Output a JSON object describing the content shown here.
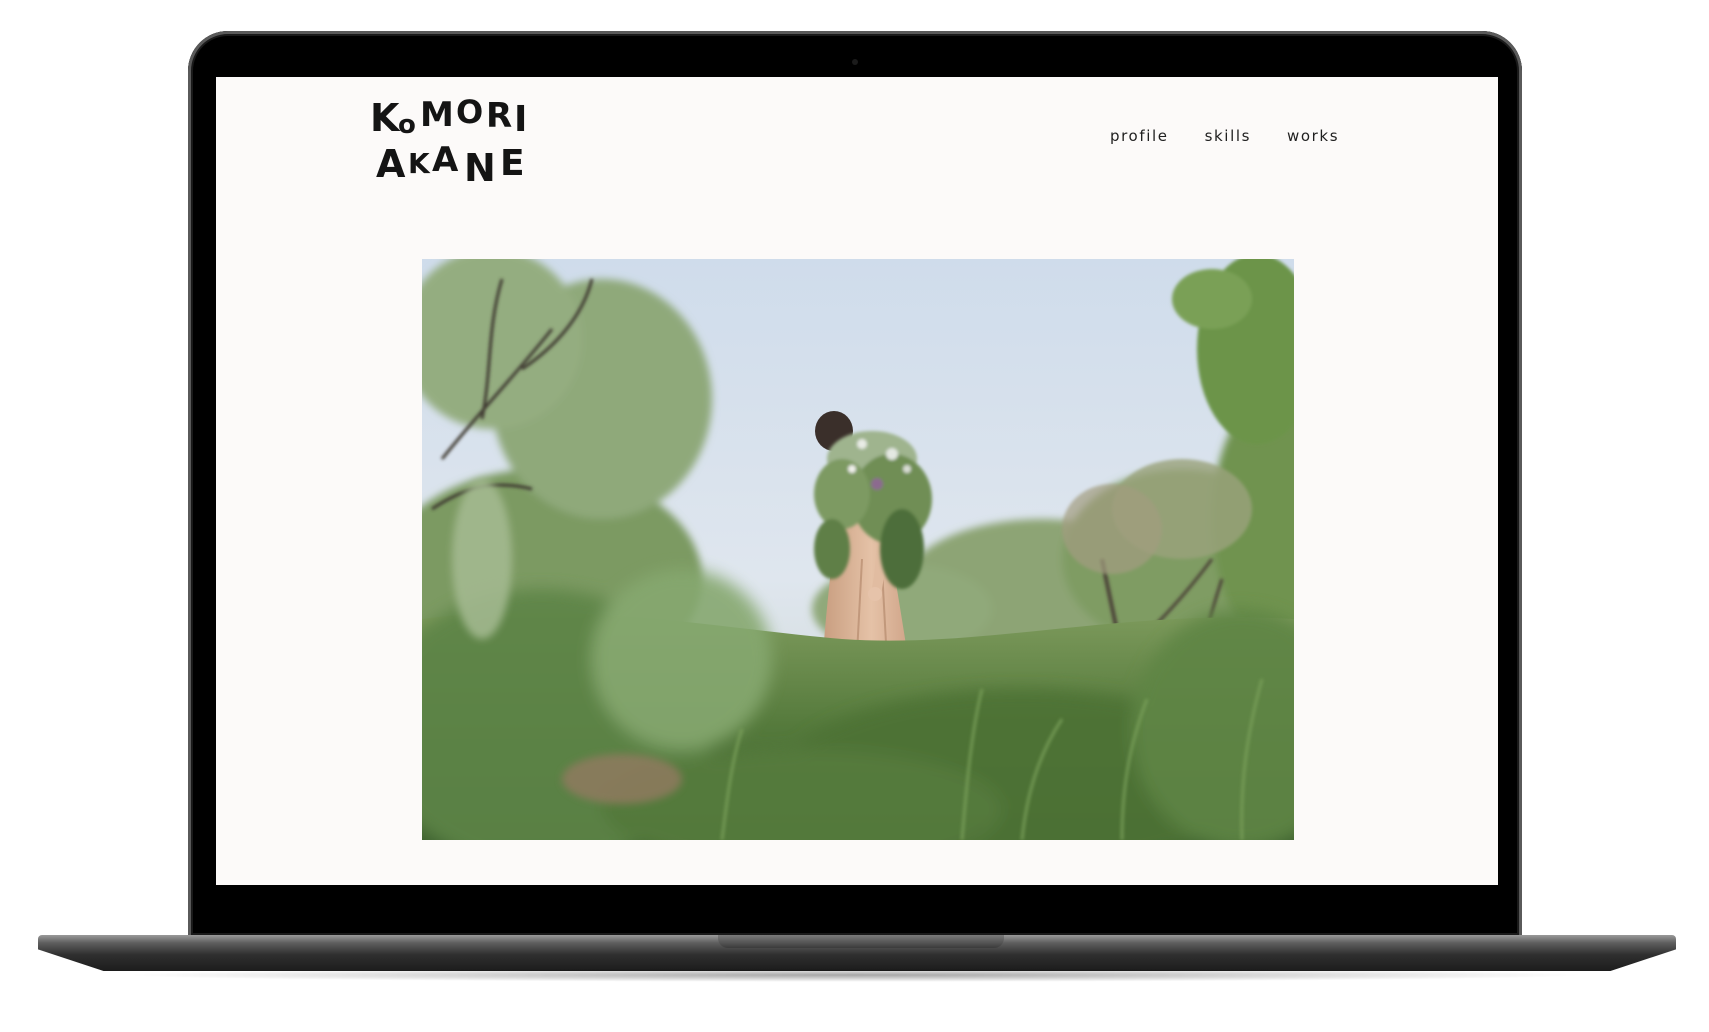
{
  "site": {
    "logo": {
      "line1": [
        "K",
        "o",
        "M",
        "O",
        "R",
        "I"
      ],
      "line2": [
        "A",
        "K",
        "A",
        "N",
        "E"
      ]
    },
    "nav": {
      "items": [
        "profile",
        "skills",
        "works"
      ]
    }
  },
  "hero": {
    "image_subject": "woman-in-field-photo"
  },
  "colors": {
    "screen_bg": "#fcfaf9",
    "bezel": "#000000",
    "text": "#1f1f1f"
  }
}
